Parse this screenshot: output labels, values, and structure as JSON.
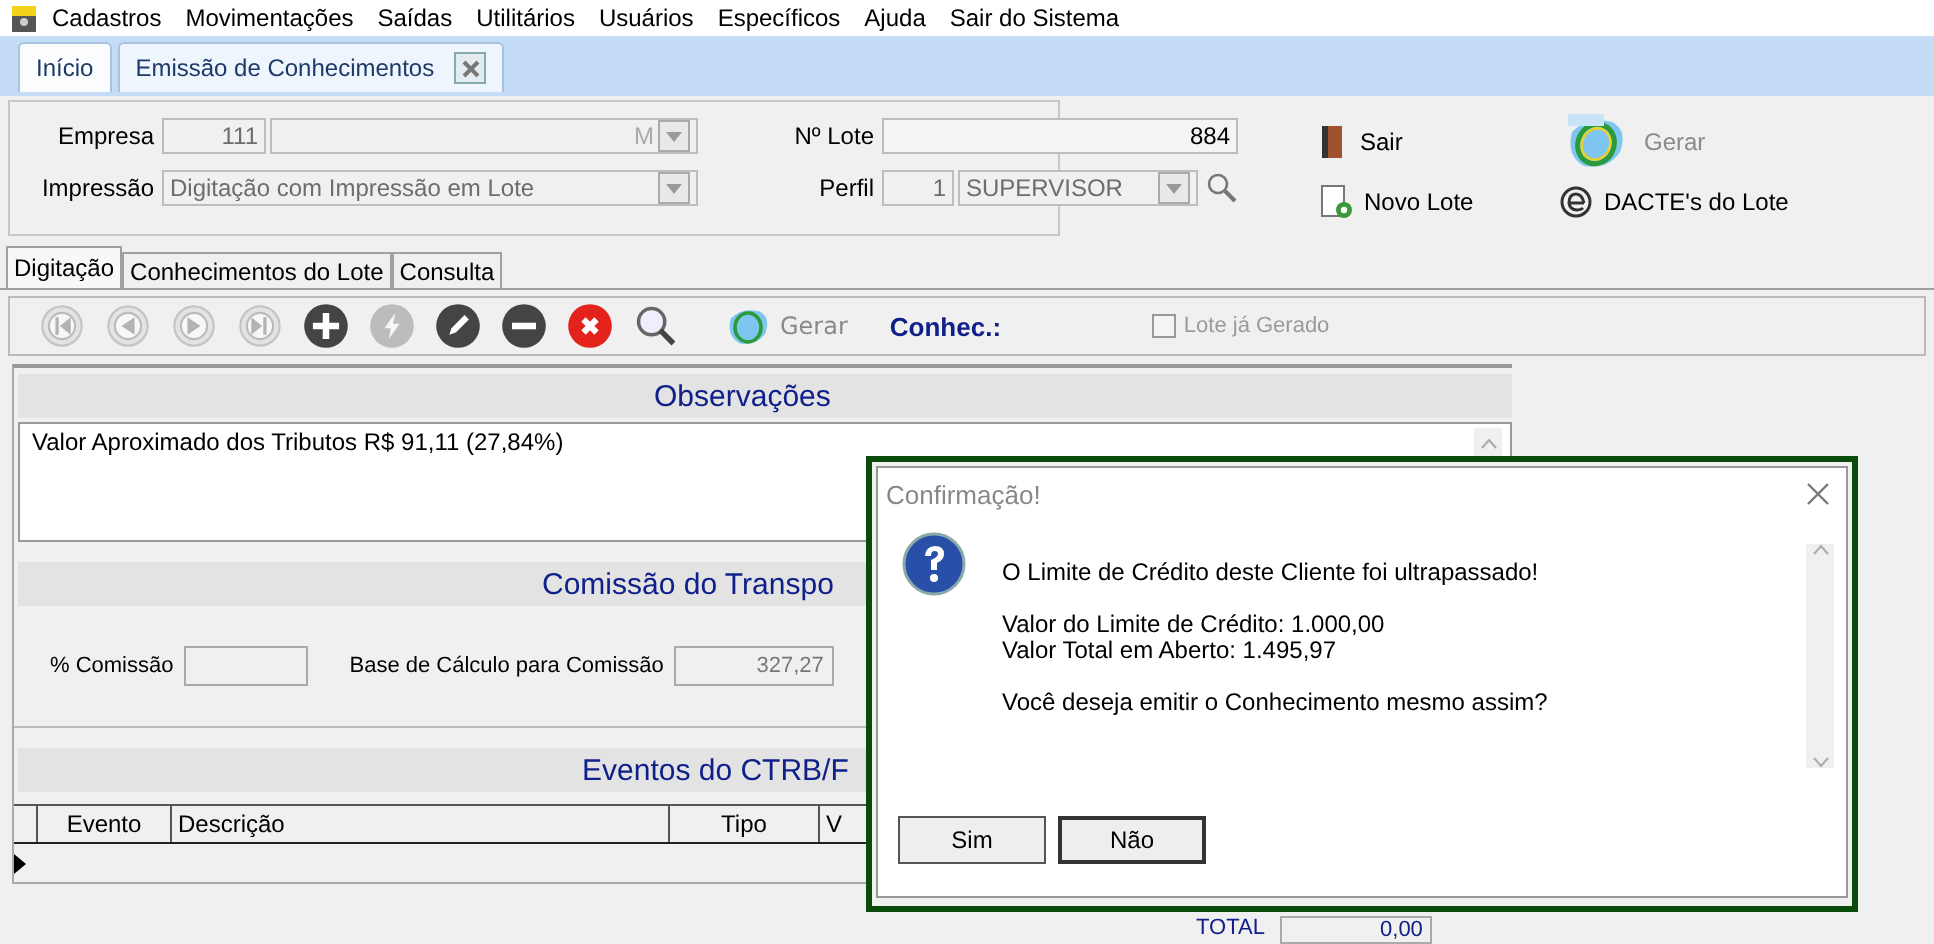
{
  "menu": [
    "Cadastros",
    "Movimentações",
    "Saídas",
    "Utilitários",
    "Usuários",
    "Específicos",
    "Ajuda",
    "Sair do Sistema"
  ],
  "doc_tabs": [
    {
      "label": "Início",
      "selected": false,
      "closable": false
    },
    {
      "label": "Emissão de Conhecimentos",
      "selected": true,
      "closable": true
    }
  ],
  "header": {
    "empresa": {
      "label": "Empresa",
      "code": "111",
      "name": "M"
    },
    "impressao": {
      "label": "Impressão",
      "value": "Digitação com Impressão em Lote"
    },
    "lote": {
      "label": "Nº Lote",
      "value": "884"
    },
    "perfil": {
      "label": "Perfil",
      "code": "1",
      "value": "SUPERVISOR"
    }
  },
  "actions": [
    {
      "kind": "exit",
      "label": "Sair",
      "disabled": false
    },
    {
      "kind": "mdfe",
      "label": "Gerar",
      "disabled": true
    },
    {
      "kind": "new",
      "label": "Novo Lote",
      "disabled": false
    },
    {
      "kind": "dacte",
      "label": "DACTE's do Lote",
      "disabled": false
    }
  ],
  "tabs": [
    {
      "label": "Digitação",
      "selected": true
    },
    {
      "label": "Conhecimentos do Lote",
      "selected": false
    },
    {
      "label": "Consulta",
      "selected": false
    }
  ],
  "toolbar": {
    "buttons": [
      {
        "kind": "first",
        "disabled": true
      },
      {
        "kind": "prev",
        "disabled": true
      },
      {
        "kind": "next",
        "disabled": true
      },
      {
        "kind": "last",
        "disabled": true
      },
      {
        "kind": "add",
        "disabled": false
      },
      {
        "kind": "bolt",
        "disabled": true
      },
      {
        "kind": "edit",
        "disabled": false
      },
      {
        "kind": "remove",
        "disabled": false
      },
      {
        "kind": "cancel",
        "disabled": false
      },
      {
        "kind": "search",
        "disabled": false
      }
    ],
    "generate": "Gerar",
    "conhec_label": "Conhec.:",
    "lote_gerado": {
      "label": "Lote já Gerado",
      "checked": false
    }
  },
  "observacoes": {
    "title": "Observações",
    "text": "Valor Aproximado dos Tributos R$ 91,11 (27,84%)"
  },
  "comissao": {
    "title": "Comissão do Transpo",
    "percent_label": "% Comissão",
    "base_label": "Base de Cálculo para Comissão",
    "base_value": "327,27"
  },
  "eventos": {
    "title": "Eventos do CTRB/F",
    "columns": [
      "Evento",
      "Descrição",
      "Tipo",
      "V"
    ]
  },
  "totals": {
    "label": "TOTAL",
    "value": "0,00"
  },
  "dialog": {
    "title": "Confirmação!",
    "paragraphs": [
      [
        "O Limite de Crédito deste Cliente foi ultrapassado!"
      ],
      [
        "Valor do Limite de Crédito: 1.000,00",
        "Valor Total em Aberto: 1.495,97"
      ],
      [
        "Você deseja emitir o Conhecimento mesmo assim?"
      ]
    ],
    "buttons": [
      "Sim",
      "Não"
    ]
  }
}
